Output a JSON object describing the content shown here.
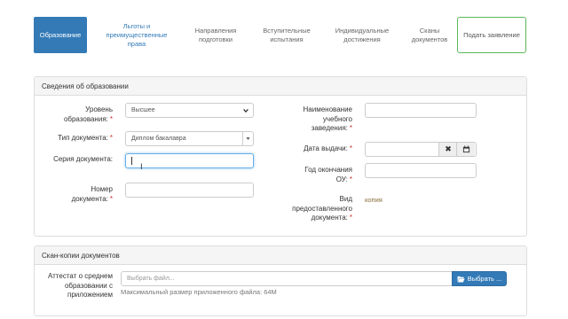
{
  "tabs": [
    {
      "label": "Образование",
      "state": "active"
    },
    {
      "label": "Льготы и преимущественные права",
      "state": "link"
    },
    {
      "label": "Направления подготовки",
      "state": "normal"
    },
    {
      "label": "Вступительные испытания",
      "state": "normal"
    },
    {
      "label": "Индивидуальные достижения",
      "state": "normal"
    },
    {
      "label": "Сканы документов",
      "state": "normal"
    },
    {
      "label": "Подать заявление",
      "state": "submit"
    }
  ],
  "education": {
    "heading": "Сведения об образовании",
    "level_label": "Уровень образования:",
    "level_value": "Высшее",
    "doc_type_label": "Тип документа:",
    "doc_type_value": "Диплом бакалавра",
    "series_label": "Серия документа:",
    "series_value": "",
    "number_label": "Номер документа:",
    "number_value": "",
    "institution_label": "Наименование учебного заведения:",
    "institution_value": "",
    "issue_date_label": "Дата выдачи:",
    "issue_date_value": "",
    "grad_year_label": "Год окончания ОУ:",
    "grad_year_value": "",
    "provided_kind_label": "Вид предоставленного документа:",
    "provided_kind_value": "копия",
    "required_mark": "*"
  },
  "scans": {
    "heading": "Скан-копии документов",
    "attestat_label": "Аттестат о среднем образовании с приложением",
    "file_placeholder": "Выбрать файл...",
    "choose_button": "Выбрать ...",
    "max_size_hint": "Максимальный размер приложенного файла: 64M"
  },
  "colors": {
    "primary": "#337ab7",
    "success_border": "#5cb85c",
    "required": "#c9302c",
    "value_text": "#8a6d3b"
  }
}
